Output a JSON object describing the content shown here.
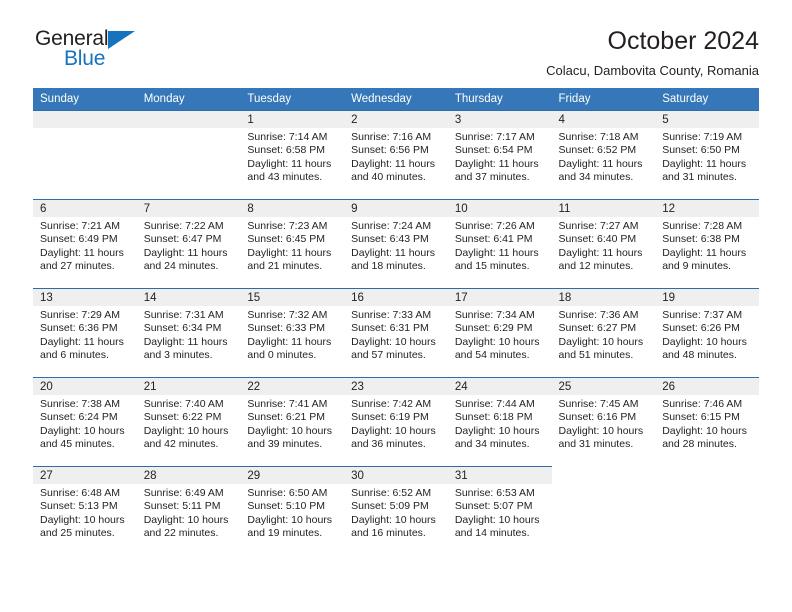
{
  "logo": {
    "word_top": "General",
    "word_bottom": "Blue",
    "triangle_color": "#1673be"
  },
  "header": {
    "title": "October 2024",
    "subtitle": "Colacu, Dambovita County, Romania"
  },
  "theme": {
    "header_blue": "#3577b8",
    "separator_blue": "#2e6da7",
    "date_band_gray": "#efefef",
    "text": "#231f20"
  },
  "weekday_headers": [
    "Sunday",
    "Monday",
    "Tuesday",
    "Wednesday",
    "Thursday",
    "Friday",
    "Saturday"
  ],
  "labels": {
    "sunrise_prefix": "Sunrise:",
    "sunset_prefix": "Sunset:",
    "daylight_prefix": "Daylight:"
  },
  "weeks": [
    [
      {
        "day": "",
        "blank": true
      },
      {
        "day": "",
        "blank": true
      },
      {
        "day": "1",
        "sunrise": "Sunrise: 7:14 AM",
        "sunset": "Sunset: 6:58 PM",
        "daylight": "Daylight: 11 hours and 43 minutes."
      },
      {
        "day": "2",
        "sunrise": "Sunrise: 7:16 AM",
        "sunset": "Sunset: 6:56 PM",
        "daylight": "Daylight: 11 hours and 40 minutes."
      },
      {
        "day": "3",
        "sunrise": "Sunrise: 7:17 AM",
        "sunset": "Sunset: 6:54 PM",
        "daylight": "Daylight: 11 hours and 37 minutes."
      },
      {
        "day": "4",
        "sunrise": "Sunrise: 7:18 AM",
        "sunset": "Sunset: 6:52 PM",
        "daylight": "Daylight: 11 hours and 34 minutes."
      },
      {
        "day": "5",
        "sunrise": "Sunrise: 7:19 AM",
        "sunset": "Sunset: 6:50 PM",
        "daylight": "Daylight: 11 hours and 31 minutes."
      }
    ],
    [
      {
        "day": "6",
        "sunrise": "Sunrise: 7:21 AM",
        "sunset": "Sunset: 6:49 PM",
        "daylight": "Daylight: 11 hours and 27 minutes."
      },
      {
        "day": "7",
        "sunrise": "Sunrise: 7:22 AM",
        "sunset": "Sunset: 6:47 PM",
        "daylight": "Daylight: 11 hours and 24 minutes."
      },
      {
        "day": "8",
        "sunrise": "Sunrise: 7:23 AM",
        "sunset": "Sunset: 6:45 PM",
        "daylight": "Daylight: 11 hours and 21 minutes."
      },
      {
        "day": "9",
        "sunrise": "Sunrise: 7:24 AM",
        "sunset": "Sunset: 6:43 PM",
        "daylight": "Daylight: 11 hours and 18 minutes."
      },
      {
        "day": "10",
        "sunrise": "Sunrise: 7:26 AM",
        "sunset": "Sunset: 6:41 PM",
        "daylight": "Daylight: 11 hours and 15 minutes."
      },
      {
        "day": "11",
        "sunrise": "Sunrise: 7:27 AM",
        "sunset": "Sunset: 6:40 PM",
        "daylight": "Daylight: 11 hours and 12 minutes."
      },
      {
        "day": "12",
        "sunrise": "Sunrise: 7:28 AM",
        "sunset": "Sunset: 6:38 PM",
        "daylight": "Daylight: 11 hours and 9 minutes."
      }
    ],
    [
      {
        "day": "13",
        "sunrise": "Sunrise: 7:29 AM",
        "sunset": "Sunset: 6:36 PM",
        "daylight": "Daylight: 11 hours and 6 minutes."
      },
      {
        "day": "14",
        "sunrise": "Sunrise: 7:31 AM",
        "sunset": "Sunset: 6:34 PM",
        "daylight": "Daylight: 11 hours and 3 minutes."
      },
      {
        "day": "15",
        "sunrise": "Sunrise: 7:32 AM",
        "sunset": "Sunset: 6:33 PM",
        "daylight": "Daylight: 11 hours and 0 minutes."
      },
      {
        "day": "16",
        "sunrise": "Sunrise: 7:33 AM",
        "sunset": "Sunset: 6:31 PM",
        "daylight": "Daylight: 10 hours and 57 minutes."
      },
      {
        "day": "17",
        "sunrise": "Sunrise: 7:34 AM",
        "sunset": "Sunset: 6:29 PM",
        "daylight": "Daylight: 10 hours and 54 minutes."
      },
      {
        "day": "18",
        "sunrise": "Sunrise: 7:36 AM",
        "sunset": "Sunset: 6:27 PM",
        "daylight": "Daylight: 10 hours and 51 minutes."
      },
      {
        "day": "19",
        "sunrise": "Sunrise: 7:37 AM",
        "sunset": "Sunset: 6:26 PM",
        "daylight": "Daylight: 10 hours and 48 minutes."
      }
    ],
    [
      {
        "day": "20",
        "sunrise": "Sunrise: 7:38 AM",
        "sunset": "Sunset: 6:24 PM",
        "daylight": "Daylight: 10 hours and 45 minutes."
      },
      {
        "day": "21",
        "sunrise": "Sunrise: 7:40 AM",
        "sunset": "Sunset: 6:22 PM",
        "daylight": "Daylight: 10 hours and 42 minutes."
      },
      {
        "day": "22",
        "sunrise": "Sunrise: 7:41 AM",
        "sunset": "Sunset: 6:21 PM",
        "daylight": "Daylight: 10 hours and 39 minutes."
      },
      {
        "day": "23",
        "sunrise": "Sunrise: 7:42 AM",
        "sunset": "Sunset: 6:19 PM",
        "daylight": "Daylight: 10 hours and 36 minutes."
      },
      {
        "day": "24",
        "sunrise": "Sunrise: 7:44 AM",
        "sunset": "Sunset: 6:18 PM",
        "daylight": "Daylight: 10 hours and 34 minutes."
      },
      {
        "day": "25",
        "sunrise": "Sunrise: 7:45 AM",
        "sunset": "Sunset: 6:16 PM",
        "daylight": "Daylight: 10 hours and 31 minutes."
      },
      {
        "day": "26",
        "sunrise": "Sunrise: 7:46 AM",
        "sunset": "Sunset: 6:15 PM",
        "daylight": "Daylight: 10 hours and 28 minutes."
      }
    ],
    [
      {
        "day": "27",
        "sunrise": "Sunrise: 6:48 AM",
        "sunset": "Sunset: 5:13 PM",
        "daylight": "Daylight: 10 hours and 25 minutes."
      },
      {
        "day": "28",
        "sunrise": "Sunrise: 6:49 AM",
        "sunset": "Sunset: 5:11 PM",
        "daylight": "Daylight: 10 hours and 22 minutes."
      },
      {
        "day": "29",
        "sunrise": "Sunrise: 6:50 AM",
        "sunset": "Sunset: 5:10 PM",
        "daylight": "Daylight: 10 hours and 19 minutes."
      },
      {
        "day": "30",
        "sunrise": "Sunrise: 6:52 AM",
        "sunset": "Sunset: 5:09 PM",
        "daylight": "Daylight: 10 hours and 16 minutes."
      },
      {
        "day": "31",
        "sunrise": "Sunrise: 6:53 AM",
        "sunset": "Sunset: 5:07 PM",
        "daylight": "Daylight: 10 hours and 14 minutes."
      },
      {
        "day": "",
        "blank": true,
        "trailing": true
      },
      {
        "day": "",
        "blank": true,
        "trailing": true
      }
    ]
  ]
}
